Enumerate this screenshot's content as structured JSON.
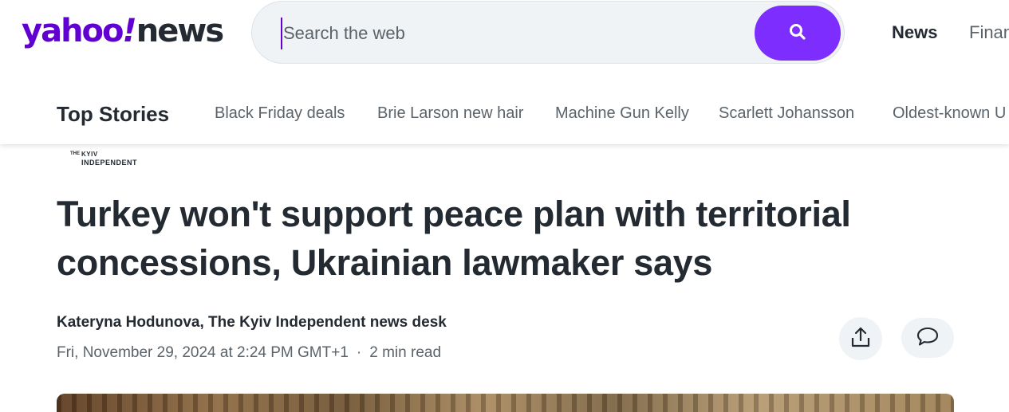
{
  "header": {
    "logo": {
      "brand": "yahoo",
      "bang": "!",
      "section": "news"
    },
    "search": {
      "placeholder": "Search the web",
      "value": "",
      "button_icon": "search-icon"
    },
    "nav": [
      {
        "label": "News"
      },
      {
        "label": "Finan"
      }
    ]
  },
  "trending": {
    "title": "Top Stories",
    "items": [
      {
        "label": "Black Friday deals"
      },
      {
        "label": "Brie Larson new hair"
      },
      {
        "label": "Machine Gun Kelly"
      },
      {
        "label": "Scarlett Johansson"
      },
      {
        "label": "Oldest-known U"
      }
    ]
  },
  "article": {
    "publisher": {
      "the": "THE",
      "name_line1": "KYIV",
      "name_line2": "INDEPENDENT"
    },
    "headline": "Turkey won't support peace plan with territorial concessions, Ukrainian lawmaker says",
    "byline": "Kateryna Hodunova, The Kyiv Independent news desk",
    "date": "Fri, November 29, 2024 at 2:24 PM GMT+1",
    "separator": "·",
    "read_time": "2 min read",
    "actions": {
      "share_icon": "share-icon",
      "comment_icon": "comment-icon"
    }
  },
  "colors": {
    "brand_purple": "#6001d2",
    "search_button": "#7d2eff",
    "text_primary": "#232a31",
    "text_secondary": "#5b636a"
  }
}
